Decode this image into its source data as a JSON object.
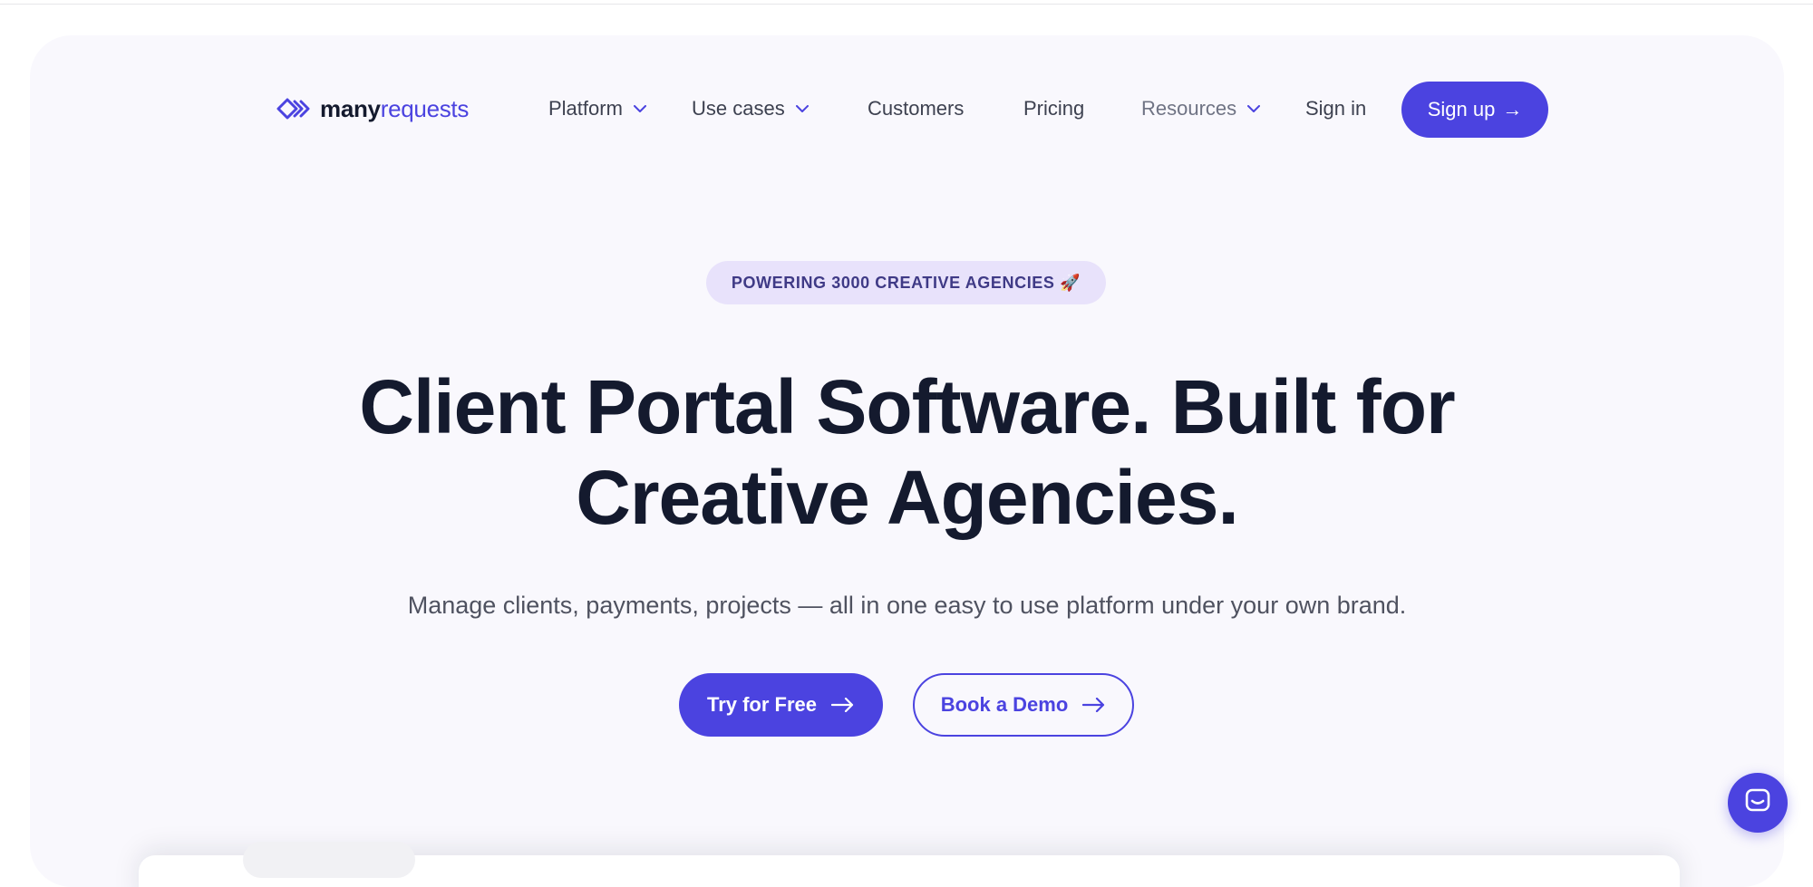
{
  "brand": {
    "name_part1": "many",
    "name_part2": "requests",
    "accent_color": "#4b43e0"
  },
  "nav": {
    "items": [
      {
        "label": "Platform",
        "has_dropdown": true
      },
      {
        "label": "Use cases",
        "has_dropdown": true
      },
      {
        "label": "Customers",
        "has_dropdown": false
      },
      {
        "label": "Pricing",
        "has_dropdown": false
      },
      {
        "label": "Resources",
        "has_dropdown": true
      }
    ],
    "signin_label": "Sign in",
    "signup_label": "Sign up",
    "signup_arrow": "→"
  },
  "hero": {
    "badge": "POWERING 3000 CREATIVE AGENCIES 🚀",
    "headline_line1": "Client Portal Software. Built for",
    "headline_line2": "Creative Agencies.",
    "subline": "Manage clients, payments, projects — all in one easy to use platform under your own brand.",
    "cta_primary": "Try for Free",
    "cta_secondary": "Book a Demo"
  },
  "icons": {
    "logo": "chevrons-logo-icon",
    "dropdown": "chevron-down-icon",
    "arrow": "arrow-right-icon",
    "chat": "chat-icon"
  }
}
